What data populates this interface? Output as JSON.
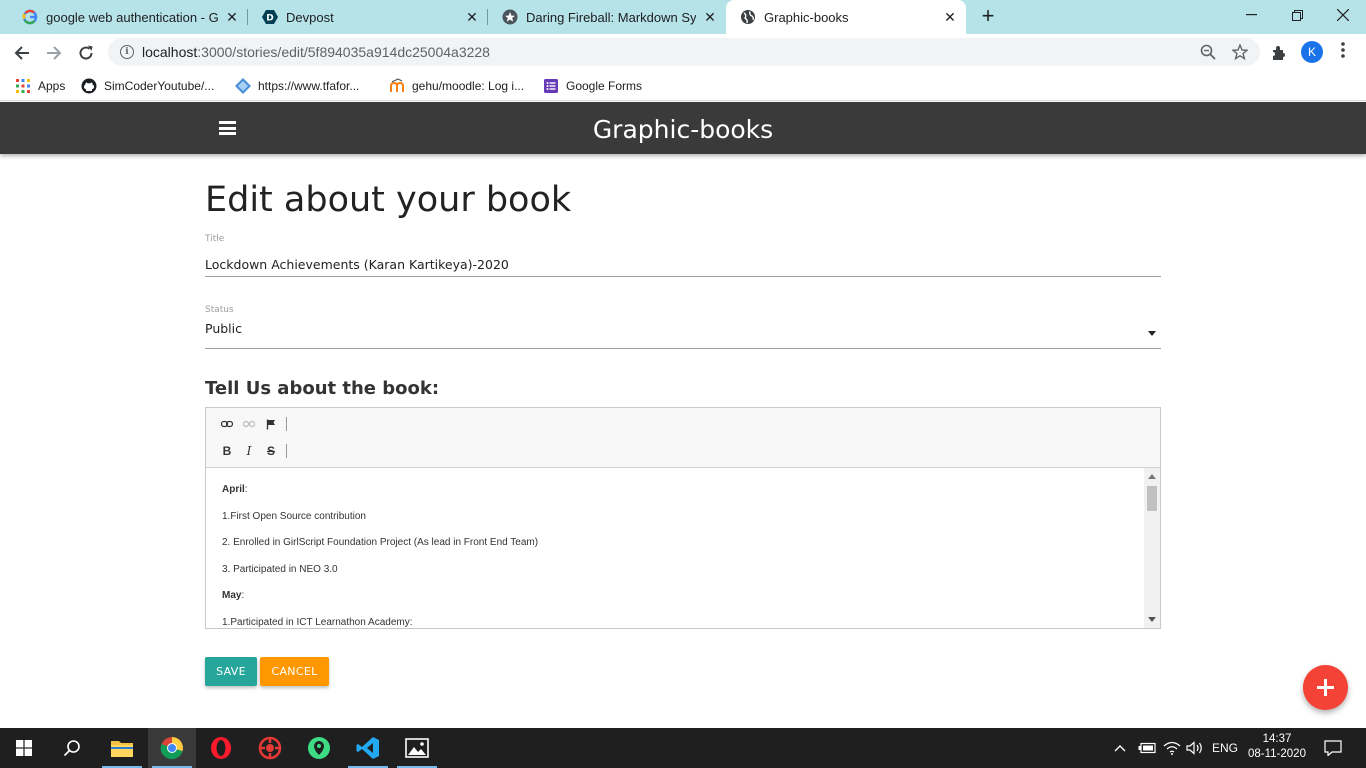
{
  "browser": {
    "tabs": [
      {
        "title": "google web authentication - Goo",
        "favicon": "google-g-icon"
      },
      {
        "title": "Devpost",
        "favicon": "devpost-icon"
      },
      {
        "title": "Daring Fireball: Markdown Synta",
        "favicon": "star-icon"
      },
      {
        "title": "Graphic-books",
        "favicon": "globe-icon",
        "active": true
      }
    ],
    "new_tab_label": "+",
    "url_host": "localhost",
    "url_path": ":3000/stories/edit/5f894035a914dc25004a3228",
    "profile_initial": "K"
  },
  "bookmarks": [
    {
      "label": "Apps"
    },
    {
      "label": "SimCoderYoutube/..."
    },
    {
      "label": "https://www.tfafor..."
    },
    {
      "label": "gehu/moodle: Log i..."
    },
    {
      "label": "Google Forms"
    }
  ],
  "app": {
    "brand": "Graphic-books"
  },
  "form": {
    "heading": "Edit about your book",
    "title_label": "Title",
    "title_value": "Lockdown Achievements (Karan Kartikeya)-2020",
    "status_label": "Status",
    "status_value": "Public",
    "section_heading": "Tell Us about the book:",
    "editor_toolbar": {
      "row1": [
        "link-icon",
        "unlink-icon",
        "anchor-flag-icon"
      ],
      "bold": "B",
      "italic": "I",
      "strike": "S"
    },
    "editor_lines": {
      "l0": "April",
      "l0_suffix": ":",
      "l1": "1.First Open Source contribution",
      "l2": "2. Enrolled in GirlScript Foundation Project (As lead in Front End Team)",
      "l3": "3. Participated in NEO 3.0",
      "l4": "May",
      "l4_suffix": ":",
      "l5": "1.Participated in ICT Learnathon Academy:"
    },
    "save_label": "SAVE",
    "cancel_label": "CANCEL"
  },
  "colors": {
    "navbar": "#3a3a3a",
    "save": "#26a69a",
    "cancel": "#ff9800",
    "fab": "#f44336",
    "tabstrip": "#b5e3e7"
  },
  "taskbar": {
    "lang": "ENG",
    "time": "14:37",
    "date": "08-11-2020"
  }
}
